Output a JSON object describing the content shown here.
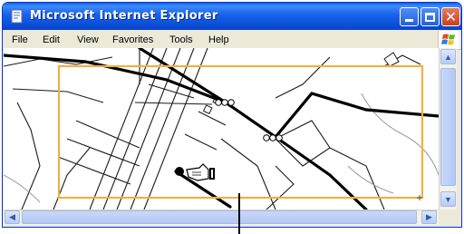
{
  "window": {
    "title": "Microsoft Internet Explorer"
  },
  "menubar": {
    "items": [
      "File",
      "Edit",
      "View",
      "Favorites",
      "Tools",
      "Help"
    ]
  },
  "icons": {
    "app": "ie-page-icon",
    "minimize": "minimize-icon",
    "maximize": "maximize-icon",
    "close": "close-icon",
    "throbber": "windows-logo-icon",
    "cursor": "pan-hand-cursor-icon"
  },
  "colors": {
    "titlebar": "#0a4fd8",
    "selection_rect": "#f0b040",
    "road_major": "#000000",
    "road_minor": "#1a1a1a",
    "trail": "#9a9a9a"
  }
}
